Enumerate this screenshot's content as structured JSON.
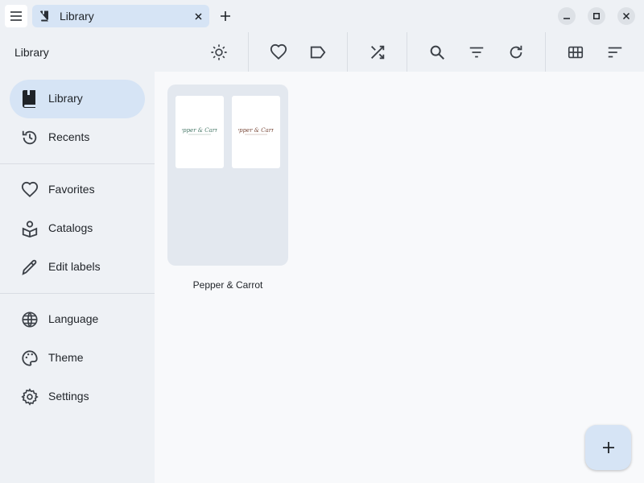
{
  "titlebar": {
    "menu_icon": "hamburger-icon",
    "tab": {
      "title": "Library",
      "icon": "book-icon",
      "close_icon": "close-icon"
    },
    "new_tab_icon": "plus-icon",
    "window_controls": [
      "minimize-icon",
      "maximize-icon",
      "close-icon"
    ]
  },
  "toolbar": {
    "title": "Library",
    "buttons": [
      "brightness-icon",
      "heart-icon",
      "label-icon",
      "shuffle-icon",
      "search-icon",
      "filter-icon",
      "refresh-icon",
      "grid-icon",
      "sort-icon"
    ]
  },
  "sidebar": {
    "items": [
      {
        "label": "Library",
        "icon": "book-icon",
        "active": true
      },
      {
        "label": "Recents",
        "icon": "history-icon"
      },
      {
        "label": "Favorites",
        "icon": "heart-icon"
      },
      {
        "label": "Catalogs",
        "icon": "catalog-icon"
      },
      {
        "label": "Edit labels",
        "icon": "pencil-icon"
      },
      {
        "label": "Language",
        "icon": "globe-icon"
      },
      {
        "label": "Theme",
        "icon": "palette-icon"
      },
      {
        "label": "Settings",
        "icon": "gear-icon"
      }
    ]
  },
  "main": {
    "catalogs": [
      {
        "label": "Pepper & Carrot",
        "covers": [
          "Pepper & Carrot",
          "Pepper & Carrot"
        ]
      }
    ],
    "fab_icon": "plus-icon"
  },
  "colors": {
    "accent": "#d6e4f5",
    "chrome": "#eef1f5",
    "content": "#f8f9fb",
    "card": "#e3e8ef"
  }
}
